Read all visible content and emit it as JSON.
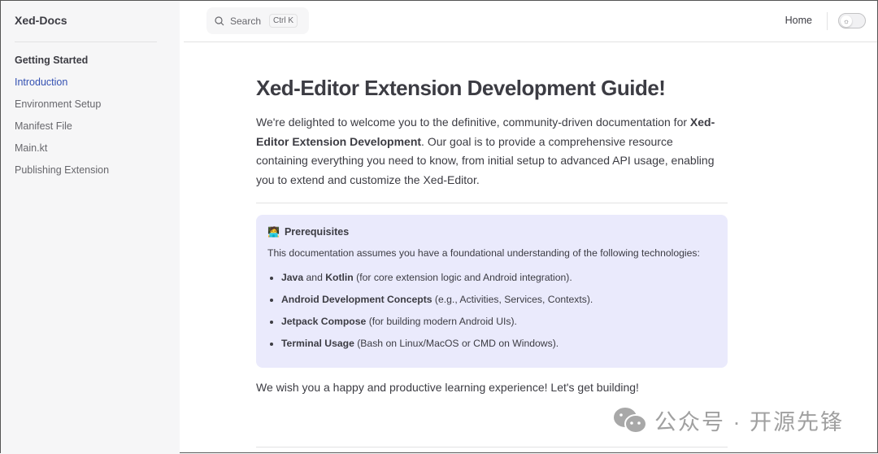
{
  "sidebar": {
    "logo": "Xed-Docs",
    "section": "Getting Started",
    "items": [
      {
        "label": "Introduction"
      },
      {
        "label": "Environment Setup"
      },
      {
        "label": "Manifest File"
      },
      {
        "label": "Main.kt"
      },
      {
        "label": "Publishing Extension"
      }
    ]
  },
  "topbar": {
    "search_label": "Search",
    "shortcut": "Ctrl K",
    "home": "Home"
  },
  "main": {
    "title": "Xed-Editor Extension Development Guide!",
    "intro_pre": "We're delighted to welcome you to the definitive, community-driven documentation for ",
    "intro_bold": "Xed-Editor Extension Development",
    "intro_post": ". Our goal is to provide a comprehensive resource containing everything you need to know, from initial setup to advanced API usage, enabling you to extend and customize the Xed-Editor.",
    "tip": {
      "title": "Prerequisites",
      "text": "This documentation assumes you have a foundational understanding of the following technologies:",
      "items": [
        {
          "b1": "Java",
          "mid": " and ",
          "b2": "Kotlin",
          "rest": " (for core extension logic and Android integration)."
        },
        {
          "b1": "Android Development Concepts",
          "mid": "",
          "b2": "",
          "rest": " (e.g., Activities, Services, Contexts)."
        },
        {
          "b1": "Jetpack Compose",
          "mid": "",
          "b2": "",
          "rest": " (for building modern Android UIs)."
        },
        {
          "b1": "Terminal Usage",
          "mid": "",
          "b2": "",
          "rest": " (Bash on Linux/MacOS or CMD on Windows)."
        }
      ]
    },
    "outro": "We wish you a happy and productive learning experience! Let's get building!"
  },
  "watermark": "公众号 · 开源先锋",
  "colors": {
    "accent": "#3451b2",
    "tip_bg": "#eaeafc",
    "sidebar_bg": "#f6f6f7"
  }
}
